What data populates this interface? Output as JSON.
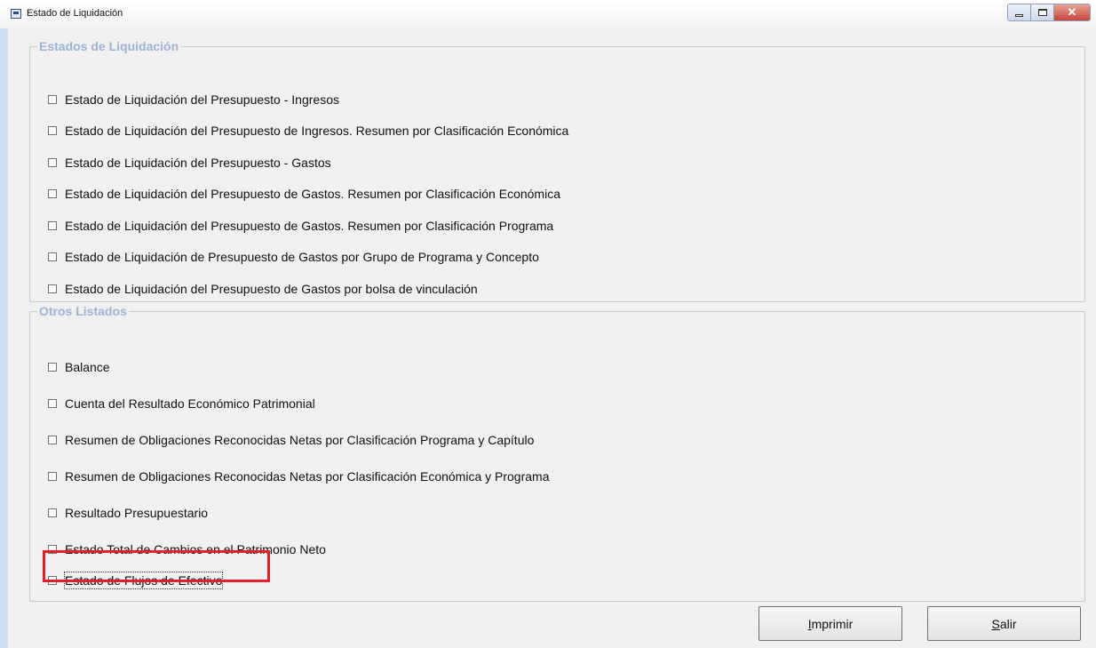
{
  "window": {
    "title": "Estado de Liquidación"
  },
  "group_liquidacion": {
    "legend": "Estados de Liquidación",
    "items": [
      {
        "label": "Estado de Liquidación del Presupuesto - Ingresos",
        "checked": false
      },
      {
        "label": "Estado de Liquidación del Presupuesto de Ingresos. Resumen por Clasificación Económica",
        "checked": false
      },
      {
        "label": "Estado de Liquidación del Presupuesto - Gastos",
        "checked": false
      },
      {
        "label": "Estado de Liquidación del Presupuesto de Gastos. Resumen por Clasificación Económica",
        "checked": false
      },
      {
        "label": "Estado de Liquidación del Presupuesto de Gastos. Resumen por Clasificación Programa",
        "checked": false
      },
      {
        "label": "Estado de Liquidación de Presupuesto de Gastos por Grupo de Programa y Concepto",
        "checked": false
      },
      {
        "label": "Estado de Liquidación del Presupuesto de Gastos por bolsa de vinculación",
        "checked": false
      }
    ]
  },
  "group_otros": {
    "legend": "Otros Listados",
    "items": [
      {
        "label": "Balance",
        "checked": false
      },
      {
        "label": "Cuenta del Resultado Económico Patrimonial",
        "checked": false
      },
      {
        "label": "Resumen de Obligaciones Reconocidas Netas por Clasificación Programa y Capítulo",
        "checked": false
      },
      {
        "label": "Resumen de Obligaciones Reconocidas Netas por Clasificación Económica y Programa",
        "checked": false
      },
      {
        "label": "Resultado Presupuestario",
        "checked": false
      },
      {
        "label": "Estado Total de Cambios en el Patrimonio Neto",
        "checked": false
      },
      {
        "label": "Estado de Flujos de Efectivo",
        "checked": false
      }
    ]
  },
  "buttons": {
    "print": {
      "accel": "I",
      "rest": "mprimir"
    },
    "exit": {
      "accel": "S",
      "rest": "alir"
    }
  },
  "colors": {
    "legend": "#9db4d6",
    "highlight": "#e0202a",
    "client_bg": "#f0f0f0"
  }
}
